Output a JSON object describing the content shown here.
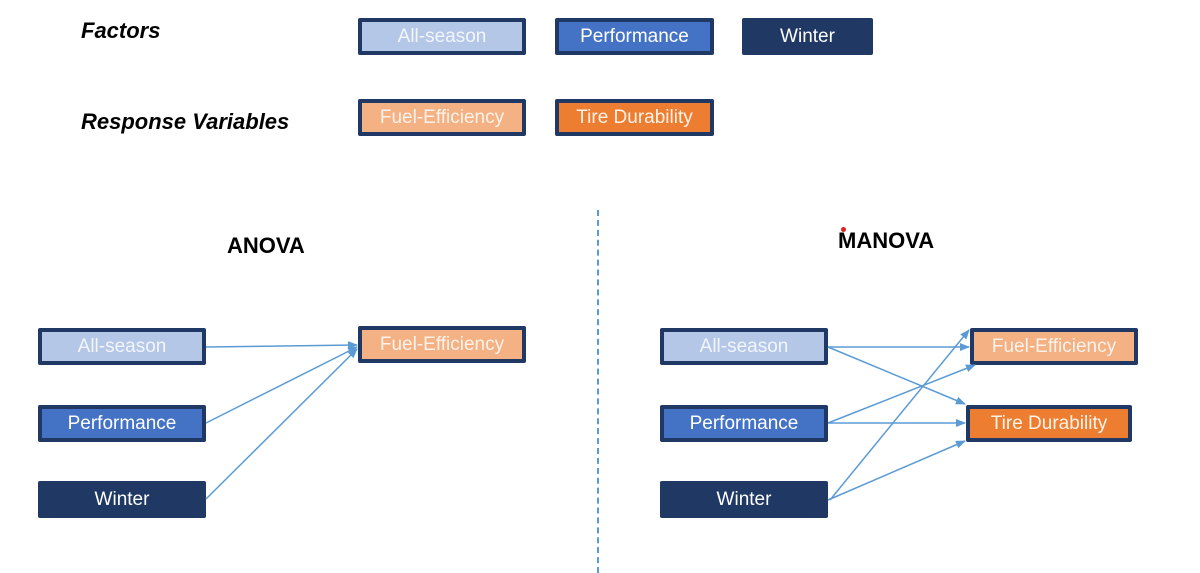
{
  "legend": {
    "factors_label": "Factors",
    "responses_label": "Response Variables",
    "factors": [
      "All-season",
      "Performance",
      "Winter"
    ],
    "responses": [
      "Fuel-Efficiency",
      "Tire Durability"
    ]
  },
  "anova": {
    "title": "ANOVA",
    "factors": [
      "All-season",
      "Performance",
      "Winter"
    ],
    "responses": [
      "Fuel-Efficiency"
    ],
    "edges": [
      [
        "All-season",
        "Fuel-Efficiency"
      ],
      [
        "Performance",
        "Fuel-Efficiency"
      ],
      [
        "Winter",
        "Fuel-Efficiency"
      ]
    ]
  },
  "manova": {
    "title": "MANOVA",
    "factors": [
      "All-season",
      "Performance",
      "Winter"
    ],
    "responses": [
      "Fuel-Efficiency",
      "Tire Durability"
    ],
    "edges": [
      [
        "All-season",
        "Fuel-Efficiency"
      ],
      [
        "All-season",
        "Tire Durability"
      ],
      [
        "Performance",
        "Fuel-Efficiency"
      ],
      [
        "Performance",
        "Tire Durability"
      ],
      [
        "Winter",
        "Fuel-Efficiency"
      ],
      [
        "Winter",
        "Tire Durability"
      ]
    ]
  },
  "colors": {
    "all_season": "#b4c7e7",
    "performance": "#4472c4",
    "winter": "#203864",
    "fuel_efficiency": "#f4b183",
    "tire_durability": "#ed7d31",
    "border": "#1f3864",
    "arrow": "#5b9bd5"
  }
}
